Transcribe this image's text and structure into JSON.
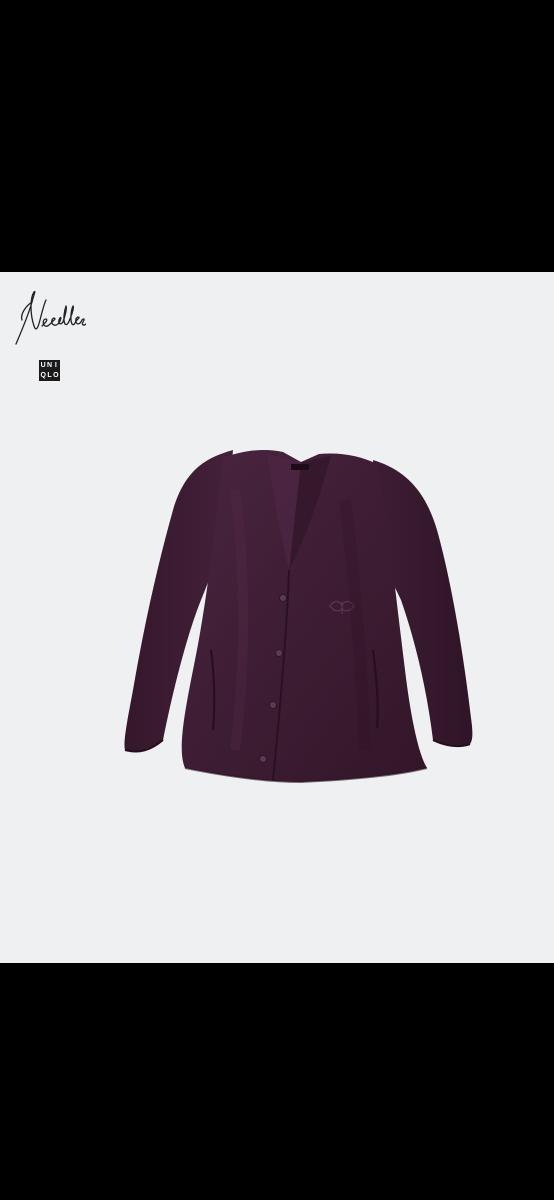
{
  "image": {
    "background_color": "#000000",
    "panel_color": "#eff0f1",
    "garment_color": "#3d1d33"
  },
  "logos": {
    "needles": {
      "text": "Needles",
      "icon": "needles-script-logo"
    },
    "uniqlo": {
      "letters": [
        "U",
        "N",
        "I",
        "Q",
        "L",
        "O"
      ],
      "icon": "uniqlo-logo",
      "color": "#1b1b1b"
    }
  },
  "product": {
    "icon": "cardigan-photo"
  }
}
